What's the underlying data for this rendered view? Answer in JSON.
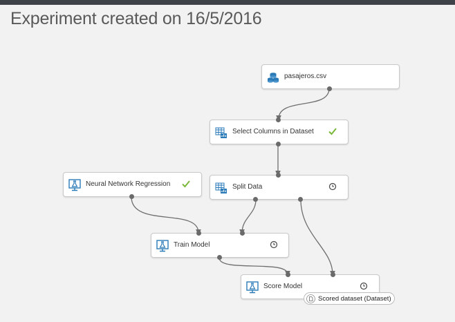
{
  "page": {
    "title": "Experiment created on 16/5/2016"
  },
  "modules": {
    "pasajeros": {
      "label": "pasajeros.csv",
      "icon": "dataset-icon",
      "status": "none"
    },
    "select_columns": {
      "label": "Select Columns in Dataset",
      "icon": "table-icon",
      "status": "success-check"
    },
    "neural_network": {
      "label": "Neural Network Regression",
      "icon": "model-icon",
      "status": "success-check"
    },
    "split_data": {
      "label": "Split Data",
      "icon": "table-icon",
      "status": "pending-clock"
    },
    "train_model": {
      "label": "Train Model",
      "icon": "model-icon",
      "status": "pending-clock"
    },
    "score_model": {
      "label": "Score Model",
      "icon": "model-icon",
      "status": "pending-clock"
    }
  },
  "tooltip": {
    "text": "Scored dataset (Dataset)",
    "icon": "document-icon"
  },
  "colors": {
    "topbar": "#3f4248",
    "check": "#7bb83a",
    "connector": "#6e6e6e",
    "icon_blue": "#2a7ab8"
  }
}
